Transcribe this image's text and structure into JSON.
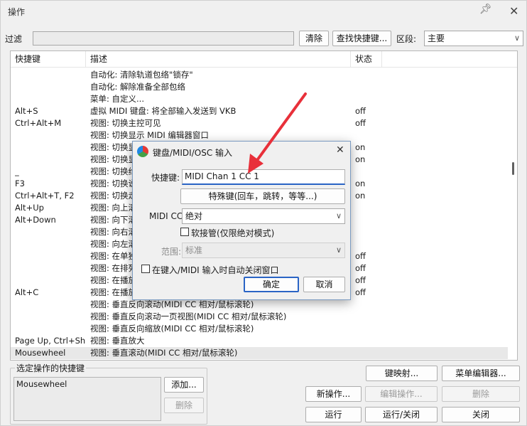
{
  "window": {
    "title": "操作",
    "pin_icon": "pin-icon",
    "close_icon": "close-icon"
  },
  "filter": {
    "label": "过滤",
    "value": "",
    "clear_button": "清除",
    "find_shortcut_button": "查找快捷键...",
    "section_label": "区段:",
    "section_value": "主要"
  },
  "list": {
    "headers": {
      "shortcut": "快捷键",
      "description": "描述",
      "state": "状态"
    },
    "rows": [
      {
        "key": "",
        "desc": "自动化: 清除轨道包络\"锁存\"",
        "state": ""
      },
      {
        "key": "",
        "desc": "自动化: 解除准备全部包络",
        "state": ""
      },
      {
        "key": "",
        "desc": "菜单: 自定义...",
        "state": ""
      },
      {
        "key": "Alt+S",
        "desc": "虚拟 MIDI 键盘: 将全部输入发送到 VKB",
        "state": "off"
      },
      {
        "key": "Ctrl+Alt+M",
        "desc": "视图: 切换主控可见",
        "state": "off"
      },
      {
        "key": "",
        "desc": "视图: 切换显示 MIDI 编辑器窗口",
        "state": ""
      },
      {
        "key": "",
        "desc": "视图: 切换显",
        "state": "on"
      },
      {
        "key": "",
        "desc": "视图: 切换显",
        "state": "on"
      },
      {
        "key": "_",
        "desc": "视图: 切换约",
        "state": ""
      },
      {
        "key": "F3",
        "desc": "视图: 切换说",
        "state": "on"
      },
      {
        "key": "Ctrl+Alt+T, F2",
        "desc": "视图: 切换走",
        "state": "on"
      },
      {
        "key": "Alt+Up",
        "desc": "视图: 向上滚",
        "state": ""
      },
      {
        "key": "Alt+Down",
        "desc": "视图: 向下滚",
        "state": ""
      },
      {
        "key": "",
        "desc": "视图: 向右滚",
        "state": ""
      },
      {
        "key": "",
        "desc": "视图: 向左滚",
        "state": ""
      },
      {
        "key": "",
        "desc": "视图: 在单独",
        "state": "off"
      },
      {
        "key": "",
        "desc": "视图: 在排列",
        "state": "off"
      },
      {
        "key": "",
        "desc": "视图: 在播放",
        "state": "off"
      },
      {
        "key": "Alt+C",
        "desc": "视图: 在播放",
        "state": "off"
      },
      {
        "key": "",
        "desc": "视图: 垂直反向滚动(MIDI CC 相对/鼠标滚轮)",
        "state": ""
      },
      {
        "key": "",
        "desc": "视图: 垂直反向滚动一页视图(MIDI CC 相对/鼠标滚轮)",
        "state": ""
      },
      {
        "key": "",
        "desc": "视图: 垂直反向缩放(MIDI CC 相对/鼠标滚轮)",
        "state": ""
      },
      {
        "key": "Page Up, Ctrl+Shif...",
        "desc": "视图: 垂直放大",
        "state": ""
      },
      {
        "key": "Mousewheel",
        "desc": "视图: 垂直滚动(MIDI CC 相对/鼠标滚轮)",
        "state": ""
      }
    ]
  },
  "selected_group": {
    "title": "选定操作的快捷键",
    "item": "Mousewheel",
    "add_button": "添加...",
    "delete_button": "删除"
  },
  "bottom_buttons": {
    "key_mapping": "键映射...",
    "menu_editor": "菜单编辑器...",
    "new_action": "新操作...",
    "edit_action": "编辑操作...",
    "delete": "删除",
    "run": "运行",
    "run_close": "运行/关闭",
    "close": "关闭"
  },
  "dialog": {
    "title": "键盘/MIDI/OSC 输入",
    "shortcut_label": "快捷键:",
    "shortcut_value": "MIDI Chan 1 CC 1",
    "special_keys_button": "特殊键(回车，跳转，等等...)",
    "midi_cc_label": "MIDI CC:",
    "midi_cc_value": "绝对",
    "soft_takeover_label": "软接管(仅限绝对模式)",
    "range_label": "范围:",
    "range_value": "标准",
    "auto_close_label": "在键入/MIDI 输入时自动关闭窗口",
    "ok_button": "确定",
    "cancel_button": "取消"
  },
  "colors": {
    "accent": "#2a64c5",
    "arrow": "#e8303a"
  }
}
